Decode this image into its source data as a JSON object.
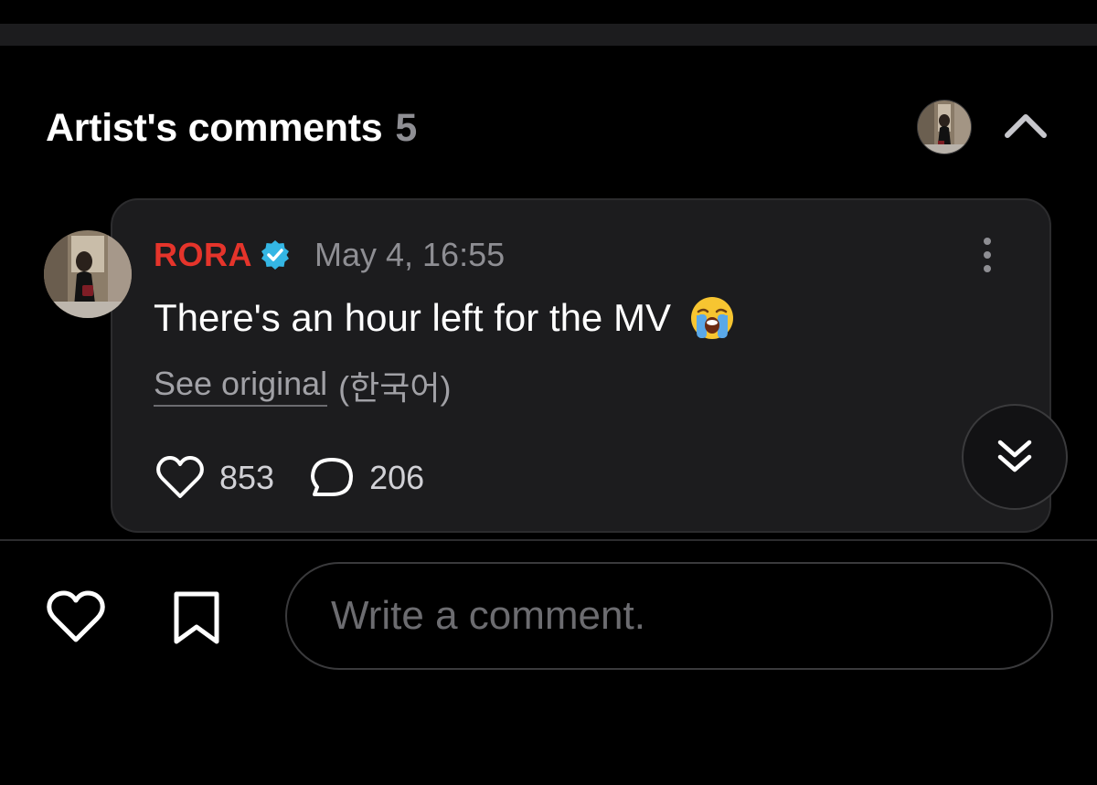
{
  "section": {
    "title": "Artist's comments",
    "count": "5"
  },
  "comment": {
    "author": "RORA",
    "verified": true,
    "time": "May 4, 16:55",
    "text": "There's an hour left for the MV",
    "emoji": "loudly-crying-face",
    "see_original_label": "See original",
    "original_language": "(한국어)",
    "likes": "853",
    "replies": "206"
  },
  "composer": {
    "placeholder": "Write a comment."
  },
  "colors": {
    "background": "#000000",
    "card": "#1c1c1e",
    "author": "#e5342b",
    "verified_badge": "#34b6e4",
    "muted_text": "#8e8e93"
  },
  "icons": {
    "collapse": "chevron-up-icon",
    "more": "more-vertical-icon",
    "like": "heart-icon",
    "reply": "speech-bubble-icon",
    "scroll_down": "double-chevron-down-icon",
    "bookmark": "bookmark-icon"
  }
}
